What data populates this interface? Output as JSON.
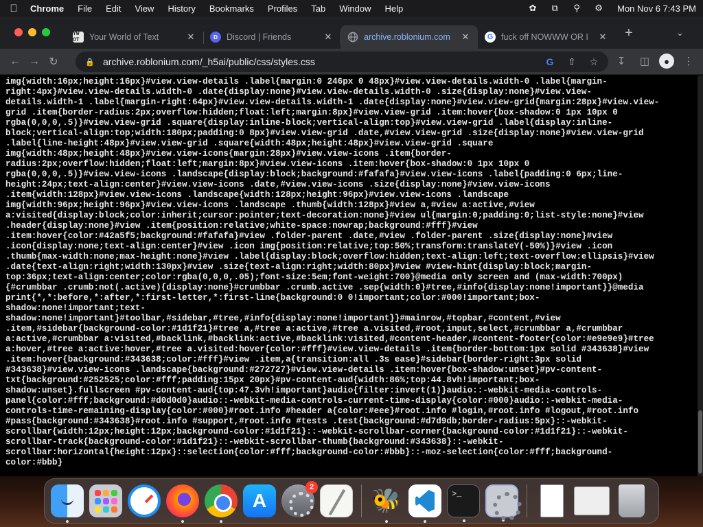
{
  "menubar": {
    "app_name": "Chrome",
    "items": [
      "File",
      "Edit",
      "View",
      "History",
      "Bookmarks",
      "Profiles",
      "Tab",
      "Window",
      "Help"
    ],
    "clock": "Mon Nov 6  7:43 PM"
  },
  "tabs": [
    {
      "title": "Your World of Text",
      "favicon_text": "YW OT",
      "active": false
    },
    {
      "title": "Discord | Friends",
      "favicon_text": "D",
      "active": false
    },
    {
      "title": "archive.roblonium.com",
      "favicon_text": "",
      "active": true
    },
    {
      "title": "fuck off NOWWW OR I",
      "favicon_text": "G",
      "active": false
    }
  ],
  "toolbar": {
    "url": "archive.roblonium.com/_h5ai/public/css/styles.css"
  },
  "page": {
    "lines": [
      "img{width:16px;height:16px}#view.view-details .label{margin:0 246px 0 48px}#view.view-details.width-0 .label{margin-",
      "right:4px}#view.view-details.width-0 .date{display:none}#view.view-details.width-0 .size{display:none}#view.view-",
      "details.width-1 .label{margin-right:64px}#view.view-details.width-1 .date{display:none}#view.view-grid{margin:28px}#view.view-",
      "grid .item{border-radius:2px;overflow:hidden;float:left;margin:8px}#view.view-grid .item:hover{box-shadow:0 1px 10px 0",
      "rgba(0,0,0,.5)}#view.view-grid .square{display:inline-block;vertical-align:top}#view.view-grid .label{display:inline-",
      "block;vertical-align:top;width:180px;padding:0 8px}#view.view-grid .date,#view.view-grid .size{display:none}#view.view-grid",
      ".label{line-height:48px}#view.view-grid .square{width:48px;height:48px}#view.view-grid .square",
      "img{width:48px;height:48px}#view.view-icons{margin:28px}#view.view-icons .item{border-",
      "radius:2px;overflow:hidden;float:left;margin:8px}#view.view-icons .item:hover{box-shadow:0 1px 10px 0",
      "rgba(0,0,0,.5)}#view.view-icons .landscape{display:block;background:#fafafa}#view.view-icons .label{padding:0 6px;line-",
      "height:24px;text-align:center}#view.view-icons .date,#view.view-icons .size{display:none}#view.view-icons",
      ".item{width:128px}#view.view-icons .landscape{width:128px;height:96px}#view.view-icons .landscape",
      "img{width:96px;height:96px}#view.view-icons .landscape .thumb{width:128px}#view a,#view a:active,#view",
      "a:visited{display:block;color:inherit;cursor:pointer;text-decoration:none}#view ul{margin:0;padding:0;list-style:none}#view",
      ".header{display:none}#view .item{position:relative;white-space:nowrap;background:#fff}#view",
      ".item:hover{color:#42a5f5;background:#fafafa}#view .folder-parent .date,#view .folder-parent .size{display:none}#view",
      ".icon{display:none;text-align:center}#view .icon img{position:relative;top:50%;transform:translateY(-50%)}#view .icon",
      ".thumb{max-width:none;max-height:none}#view .label{display:block;overflow:hidden;text-align:left;text-overflow:ellipsis}#view",
      ".date{text-align:right;width:130px}#view .size{text-align:right;width:80px}#view #view-hint{display:block;margin-",
      "top:36px;text-align:center;color:rgba(0,0,0,.05);font-size:5em;font-weight:700}@media only screen and (max-width:700px)",
      "{#crumbbar .crumb:not(.active){display:none}#crumbbar .crumb.active .sep{width:0}#tree,#info{display:none!important}}@media",
      "print{*,*:before,*:after,*:first-letter,*:first-line{background:0 0!important;color:#000!important;box-",
      "shadow:none!important;text-",
      "shadow:none!important}#toolbar,#sidebar,#tree,#info{display:none!important}}#mainrow,#topbar,#content,#view",
      ".item,#sidebar{background-color:#1d1f21}#tree a,#tree a:active,#tree a.visited,#root,input,select,#crumbbar a,#crumbbar",
      "a:active,#crumbbar a:visited,#backlink,#backlink:active,#backlink:visited,#content-header,#content-footer{color:#e9e9e9}#tree",
      "a:hover,#tree a:active:hover,#tree a.visited:hover{color:#fff}#view.view-details .item{border-bottom:1px solid #343638}#view",
      ".item:hover{background:#343638;color:#fff}#view .item,a{transition:all .3s ease}#sidebar{border-right:3px solid",
      "#343638}#view.view-icons .landscape{background:#272727}#view.view-details .item:hover{box-shadow:unset}#pv-content-",
      "txt{background:#252525;color:#fff;padding:15px 20px}#pv-content-aud{width:86%;top:44.8vh!important;box-",
      "shadow:unset}.fullscreen #pv-content-aud{top:47.3vh!important}audio{filter:invert(1)}audio::-webkit-media-controls-",
      "panel{color:#fff;background:#d0d0d0}audio::-webkit-media-controls-current-time-display{color:#000}audio::-webkit-media-",
      "controls-time-remaining-display{color:#000}#root.info #header a{color:#eee}#root.info #login,#root.info #logout,#root.info",
      "#pass{background:#343638}#root.info #support,#root.info #tests .test{background:#d7d9db;border-radius:5px}::-webkit-",
      "scrollbar{width:12px;height:12px;background-color:#1d1f21}::-webkit-scrollbar-corner{background-color:#1d1f21}::-webkit-",
      "scrollbar-track{background-color:#1d1f21}::-webkit-scrollbar-thumb{background:#343638}::-webkit-",
      "scrollbar:horizontal{height:12px}::selection{color:#fff;background-color:#bbb}::-moz-selection{color:#fff;background-",
      "color:#bbb}"
    ]
  },
  "dock": {
    "items": [
      {
        "name": "finder",
        "running": true
      },
      {
        "name": "launchpad",
        "running": false
      },
      {
        "name": "safari",
        "running": false
      },
      {
        "name": "firefox",
        "running": true
      },
      {
        "name": "chrome",
        "running": true
      },
      {
        "name": "app-store",
        "running": false
      },
      {
        "name": "system-preferences",
        "running": false,
        "badge": "2"
      },
      {
        "name": "textedit",
        "running": false
      },
      {
        "name": "bee-app",
        "running": true
      },
      {
        "name": "vscode",
        "running": true
      },
      {
        "name": "terminal",
        "running": true
      },
      {
        "name": "system-settings",
        "running": true
      },
      {
        "name": "document-stack",
        "running": false
      },
      {
        "name": "downloads-stack",
        "running": false
      },
      {
        "name": "trash",
        "running": false
      }
    ],
    "terminal_glyph": ">_",
    "appstore_glyph": "A"
  }
}
